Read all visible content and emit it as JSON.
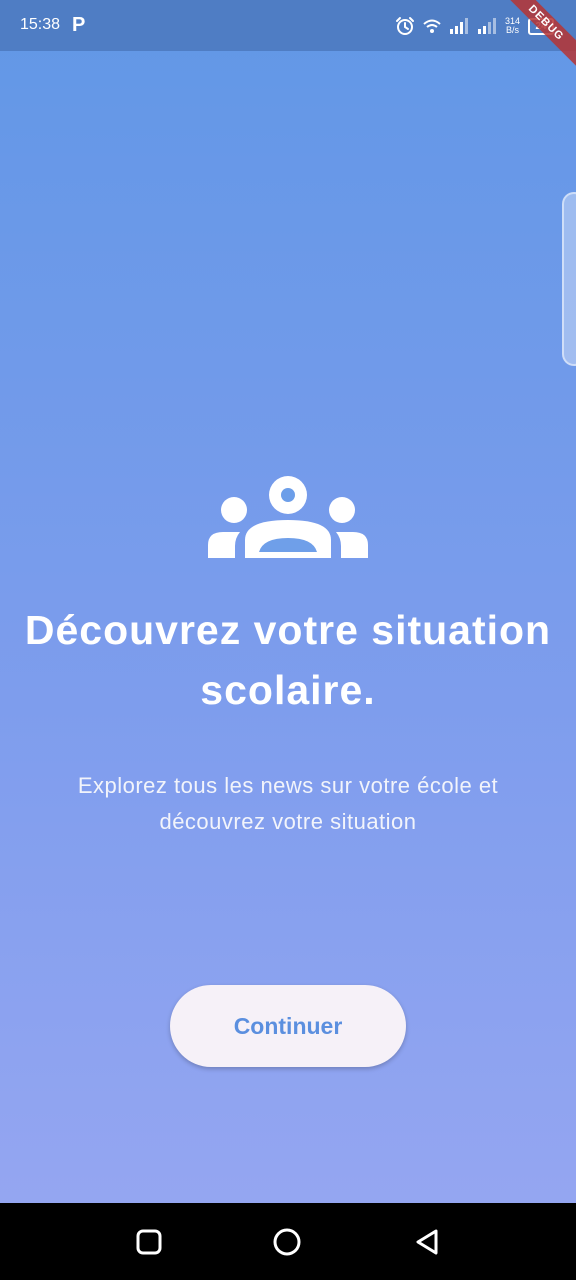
{
  "status_bar": {
    "time": "15:38",
    "app_icon_letter": "P",
    "net_speed_value": "314",
    "net_speed_unit": "B/s",
    "battery": "24",
    "debug_label": "DEBUG"
  },
  "onboarding": {
    "icon": "groups-icon",
    "title_line1": "Découvrez votre situation",
    "title_line2": "scolaire.",
    "subtitle_line1": "Explorez tous les news sur votre école et",
    "subtitle_line2": "découvrez votre situation",
    "button_label": "Continuer"
  },
  "nav_bar": {
    "icons": [
      "square-icon",
      "circle-icon",
      "back-triangle-icon"
    ]
  },
  "colors": {
    "gradient_top": "#6197e6",
    "gradient_bottom": "#98a7f2",
    "button_bg": "#f6f1f8",
    "button_text": "#5b8fdf",
    "status_bar_bg": "#4f7dc4"
  }
}
